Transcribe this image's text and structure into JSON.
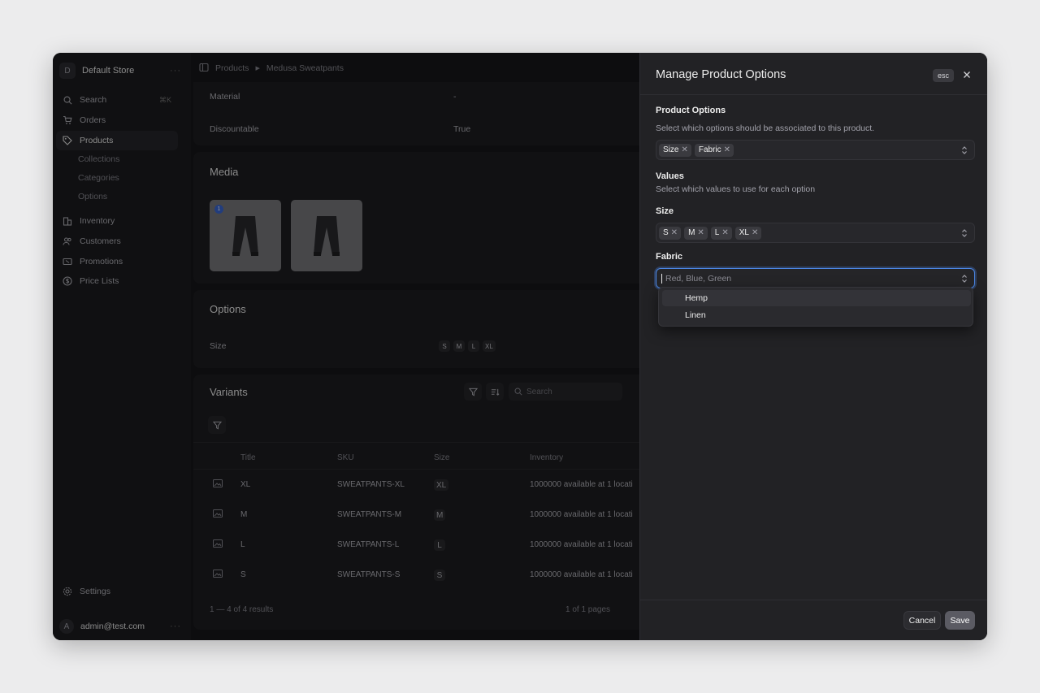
{
  "sidebar": {
    "store_initial": "D",
    "store_name": "Default Store",
    "search_label": "Search",
    "search_shortcut": "⌘K",
    "items": [
      {
        "label": "Orders",
        "icon": "cart-icon"
      },
      {
        "label": "Products",
        "icon": "tag-icon"
      },
      {
        "label": "Inventory",
        "icon": "building-icon"
      },
      {
        "label": "Customers",
        "icon": "users-icon"
      },
      {
        "label": "Promotions",
        "icon": "receipt-icon"
      },
      {
        "label": "Price Lists",
        "icon": "currency-icon"
      }
    ],
    "sub_items": [
      "Collections",
      "Categories",
      "Options"
    ],
    "settings_label": "Settings",
    "user_initial": "A",
    "user_email": "admin@test.com"
  },
  "breadcrumb": {
    "section": "Products",
    "current": "Medusa Sweatpants"
  },
  "attributes": [
    {
      "label": "Material",
      "value": "-"
    },
    {
      "label": "Discountable",
      "value": "True"
    }
  ],
  "media": {
    "title": "Media",
    "badge": "1"
  },
  "options_card": {
    "title": "Options",
    "label": "Size",
    "values": [
      "S",
      "M",
      "L",
      "XL"
    ]
  },
  "variants": {
    "title": "Variants",
    "search_placeholder": "Search",
    "columns": [
      "Title",
      "SKU",
      "Size",
      "Inventory"
    ],
    "rows": [
      {
        "title": "XL",
        "sku": "SWEATPANTS-XL",
        "size": "XL",
        "inventory": "1000000 available at 1 locati"
      },
      {
        "title": "M",
        "sku": "SWEATPANTS-M",
        "size": "M",
        "inventory": "1000000 available at 1 locati"
      },
      {
        "title": "L",
        "sku": "SWEATPANTS-L",
        "size": "L",
        "inventory": "1000000 available at 1 locati"
      },
      {
        "title": "S",
        "sku": "SWEATPANTS-S",
        "size": "S",
        "inventory": "1000000 available at 1 locati"
      }
    ],
    "results": "1 — 4 of 4 results",
    "pages": "1 of 1 pages"
  },
  "drawer": {
    "title": "Manage Product Options",
    "esc": "esc",
    "product_options_label": "Product Options",
    "product_options_hint": "Select which options should be associated to this product.",
    "selected_options": [
      "Size",
      "Fabric"
    ],
    "values_label": "Values",
    "values_hint": "Select which values to use for each option",
    "size_label": "Size",
    "size_values": [
      "S",
      "M",
      "L",
      "XL"
    ],
    "fabric_label": "Fabric",
    "fabric_placeholder": "Red, Blue, Green",
    "dropdown_options": [
      "Hemp",
      "Linen"
    ],
    "cancel": "Cancel",
    "save": "Save"
  },
  "colors": {
    "accent_focus": "#4b86e3",
    "background": "#1a1a1c",
    "drawer": "#222225"
  }
}
